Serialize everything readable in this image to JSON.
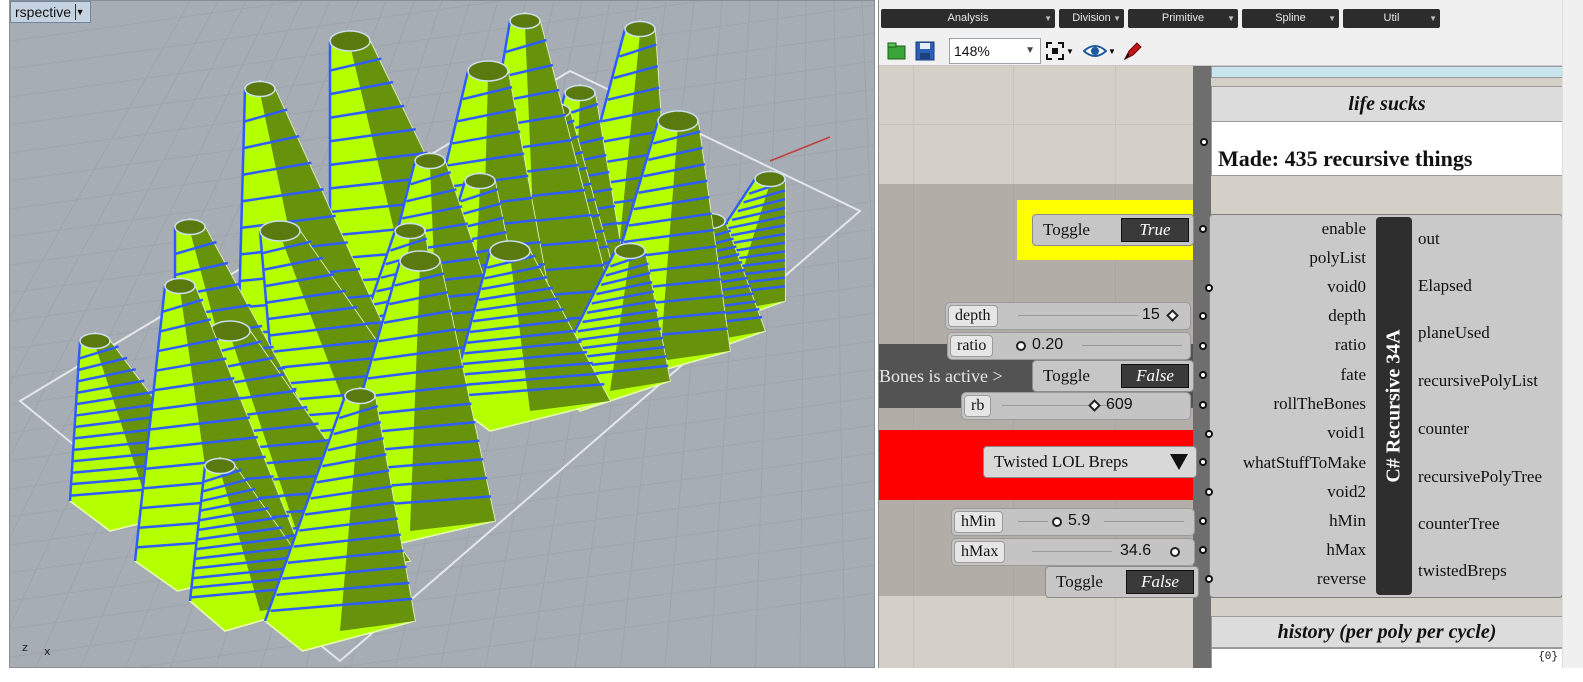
{
  "viewport": {
    "tab_label": "rspective",
    "axis_z": "z",
    "axis_x": "x",
    "colors": {
      "background": "#a7adb4",
      "surface": "#b4ff00",
      "edges": "#2f5cff"
    }
  },
  "grasshopper": {
    "category_tabs": [
      "Analysis",
      "Division",
      "Primitive",
      "Spline",
      "Util"
    ],
    "toolbar": {
      "zoom": "148%",
      "icons": [
        "open-file-icon",
        "save-icon",
        "zoom-extents-icon",
        "preview-eye-icon",
        "sketch-icon"
      ]
    },
    "panel_life": {
      "title": "life sucks",
      "text": "Made: 435 recursive things"
    },
    "bones_label": "Bones is active >",
    "toggles": {
      "enable": {
        "label": "Toggle",
        "value": "True"
      },
      "roll": {
        "label": "Toggle",
        "value": "False"
      },
      "reverse": {
        "label": "Toggle",
        "value": "False"
      }
    },
    "sliders": {
      "depth": {
        "label": "depth",
        "value": "15"
      },
      "ratio": {
        "label": "ratio",
        "value": "0.20"
      },
      "rb": {
        "label": "rb",
        "value": "609"
      },
      "hmin": {
        "label": "hMin",
        "value": "5.9"
      },
      "hmax": {
        "label": "hMax",
        "value": "34.6"
      }
    },
    "dropdown": {
      "value": "Twisted LOL Breps"
    },
    "component": {
      "name": "C# Recursive 34A",
      "inputs": [
        "enable",
        "polyList",
        "void0",
        "depth",
        "ratio",
        "fate",
        "rollTheBones",
        "void1",
        "whatStuffToMake",
        "void2",
        "hMin",
        "hMax",
        "reverse"
      ],
      "outputs": [
        "out",
        "Elapsed",
        "planeUsed",
        "recursivePolyList",
        "counter",
        "recursivePolyTree",
        "counterTree",
        "twistedBreps"
      ]
    },
    "panel_history": {
      "title": "history (per poly per cycle)",
      "index": "{0}"
    }
  }
}
